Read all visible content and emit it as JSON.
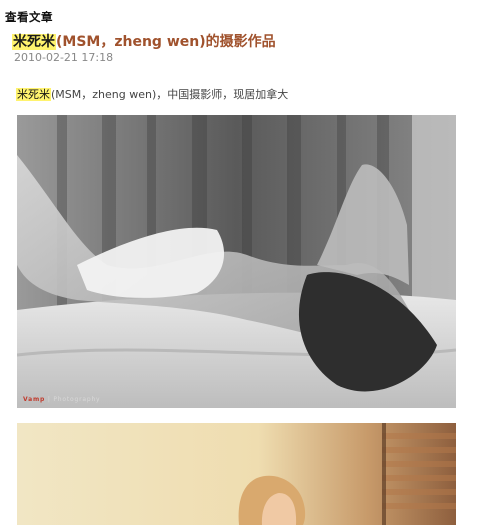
{
  "section_header": "查看文章",
  "article": {
    "title_highlight": "米死米",
    "title_rest": "(MSM，zheng wen)的摄影作品",
    "date": "2010-02-21 17:18",
    "intro_highlight": "米死米",
    "intro_rest": "(MSM，zheng wen)，中国摄影师，现居加拿大"
  },
  "photos": [
    {
      "watermark_brand": "Vamp",
      "watermark_rest": "| Photography"
    },
    {}
  ]
}
